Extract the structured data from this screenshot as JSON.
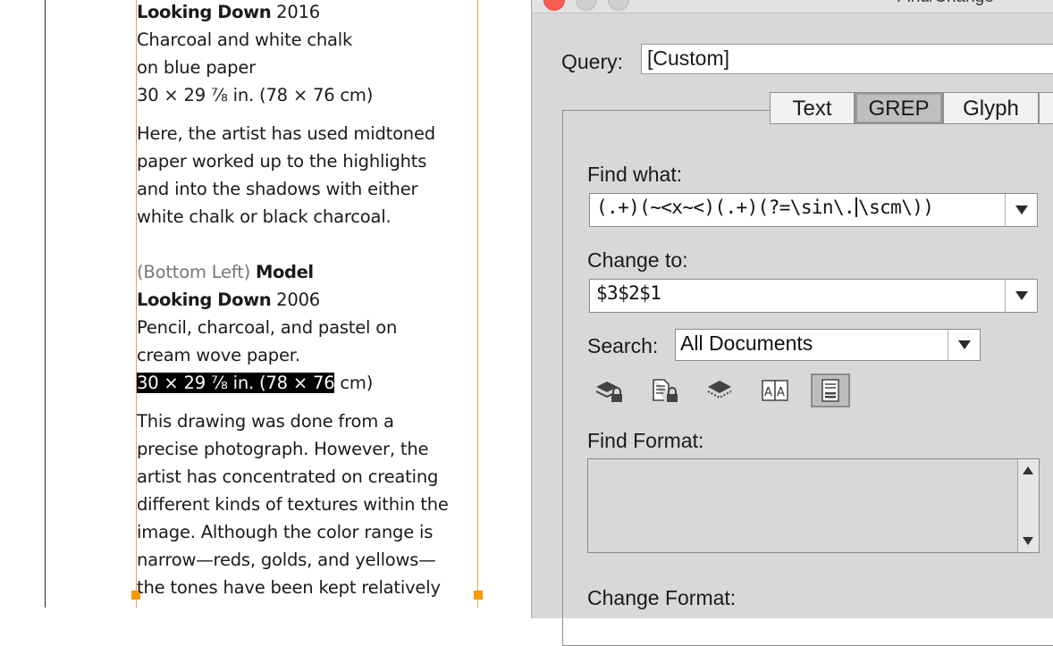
{
  "document": {
    "lines": [
      {
        "parts": [
          {
            "text": "Looking Down",
            "style": "bold"
          },
          {
            "text": "  2016",
            "style": "normal"
          }
        ]
      },
      {
        "parts": [
          {
            "text": "Charcoal and white chalk",
            "style": "normal"
          }
        ]
      },
      {
        "parts": [
          {
            "text": "on blue paper",
            "style": "normal"
          }
        ]
      },
      {
        "parts": [
          {
            "text": "30 × 29 ⅞ in. (78 × 76 cm)",
            "style": "normal"
          }
        ]
      },
      {
        "parts": [
          {
            "text": "Here, the artist has used midtoned",
            "style": "normal"
          }
        ]
      },
      {
        "parts": [
          {
            "text": "paper worked up to the highlights",
            "style": "normal"
          }
        ]
      },
      {
        "parts": [
          {
            "text": "and into the shadows with either",
            "style": "normal"
          }
        ]
      },
      {
        "parts": [
          {
            "text": "white chalk or black charcoal.",
            "style": "normal"
          }
        ]
      },
      {
        "parts": [
          {
            "text": "(Bottom Left)",
            "style": "gray"
          },
          {
            "text": "  ",
            "style": "normal"
          },
          {
            "text": "Model",
            "style": "bold"
          }
        ]
      },
      {
        "parts": [
          {
            "text": "Looking Down",
            "style": "bold"
          },
          {
            "text": "  2006",
            "style": "normal"
          }
        ]
      },
      {
        "parts": [
          {
            "text": "Pencil, charcoal, and pastel on",
            "style": "normal"
          }
        ]
      },
      {
        "parts": [
          {
            "text": "cream wove paper.",
            "style": "normal"
          }
        ]
      },
      {
        "parts": [
          {
            "text": "30 × 29 ⅞ in. (78 × 76",
            "style": "selected"
          },
          {
            "text": " cm)",
            "style": "normal"
          }
        ]
      },
      {
        "parts": [
          {
            "text": "This drawing was done from a",
            "style": "normal"
          }
        ]
      },
      {
        "parts": [
          {
            "text": "precise photograph. However, the",
            "style": "normal"
          }
        ]
      },
      {
        "parts": [
          {
            "text": "artist has concentrated on creating",
            "style": "normal"
          }
        ]
      },
      {
        "parts": [
          {
            "text": "different kinds of textures within the",
            "style": "normal"
          }
        ]
      },
      {
        "parts": [
          {
            "text": "image. Although the color range is",
            "style": "normal"
          }
        ]
      },
      {
        "parts": [
          {
            "text": "narrow—reds, golds, and yellows—",
            "style": "normal"
          }
        ]
      },
      {
        "parts": [
          {
            "text": "the tones have been kept relatively",
            "style": "normal"
          }
        ]
      }
    ]
  },
  "dialog": {
    "title": "Find/Change",
    "query_label": "Query:",
    "query_value": "[Custom]",
    "tabs": [
      {
        "label": "Text",
        "active": false
      },
      {
        "label": "GREP",
        "active": true
      },
      {
        "label": "Glyph",
        "active": false
      }
    ],
    "find_what_label": "Find what:",
    "find_what_before_caret": "(.+)(~<x~<)(.+)(?=\\sin\\.",
    "find_what_after_caret": "\\scm\\))",
    "change_to_label": "Change to:",
    "change_to_value": "$3$2$1",
    "search_label": "Search:",
    "search_value": "All Documents",
    "option_icons": [
      {
        "name": "include-locked-layers-icon",
        "active": false
      },
      {
        "name": "include-locked-stories-icon",
        "active": false
      },
      {
        "name": "include-hidden-layers-icon",
        "active": false
      },
      {
        "name": "include-master-pages-icon",
        "active": false
      },
      {
        "name": "include-footnotes-icon",
        "active": true
      }
    ],
    "find_format_label": "Find Format:",
    "change_format_label": "Change Format:"
  },
  "colors": {
    "frame_guide": "#e8a640",
    "frame_handle": "#f59a00",
    "close_button": "#fc5d55",
    "selection": "#000000"
  }
}
